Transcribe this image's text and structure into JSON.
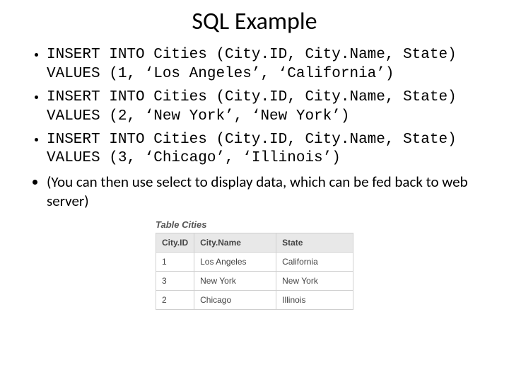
{
  "title": "SQL Example",
  "bullets": [
    "INSERT INTO Cities (City.ID, City.Name, State) VALUES (1, ‘Los Angeles’, ‘California’)",
    "INSERT INTO Cities (City.ID, City.Name, State) VALUES (2, ‘New York’, ‘New York’)",
    "INSERT INTO Cities (City.ID, City.Name, State) VALUES (3, ‘Chicago’, ‘Illinois’)",
    "(You can then use select to display data, which can be fed back to web server)"
  ],
  "table": {
    "caption": "Table Cities",
    "headers": [
      "City.ID",
      "City.Name",
      "State"
    ],
    "rows": [
      [
        "1",
        "Los Angeles",
        "California"
      ],
      [
        "3",
        "New York",
        "New York"
      ],
      [
        "2",
        "Chicago",
        "Illinois"
      ]
    ]
  }
}
